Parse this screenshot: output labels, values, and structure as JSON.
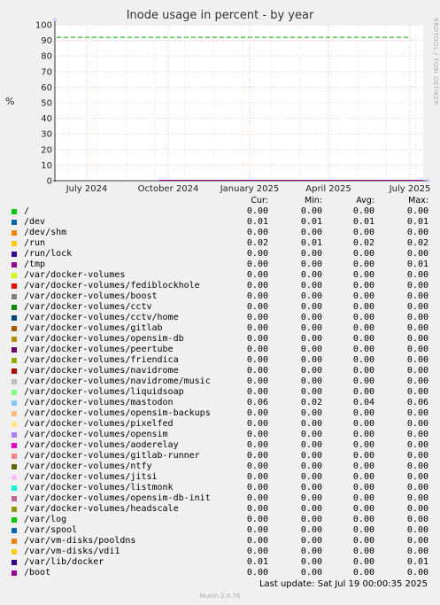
{
  "chart_data": {
    "type": "line",
    "title": "Inode usage in percent - by year",
    "ylabel": "%",
    "ylim": [
      0,
      100
    ],
    "yticks": [
      0,
      10,
      20,
      30,
      40,
      50,
      60,
      70,
      80,
      90,
      100
    ],
    "xticks": [
      "July 2024",
      "October 2024",
      "January 2025",
      "April 2025",
      "July 2025"
    ],
    "warning_line": 92,
    "grid": true,
    "legend_position": "bottom"
  },
  "sidetag": "RRDTOOL / TOBI OETIKER",
  "legend": {
    "headers": {
      "cur": "Cur:",
      "min": "Min:",
      "avg": "Avg:",
      "max": "Max:"
    },
    "rows": [
      {
        "name": "/",
        "color": "#00cc00",
        "cur": "0.00",
        "min": "0.00",
        "avg": "0.00",
        "max": "0.00"
      },
      {
        "name": "/dev",
        "color": "#0066b3",
        "cur": "0.01",
        "min": "0.01",
        "avg": "0.01",
        "max": "0.01"
      },
      {
        "name": "/dev/shm",
        "color": "#ff8000",
        "cur": "0.00",
        "min": "0.00",
        "avg": "0.00",
        "max": "0.00"
      },
      {
        "name": "/run",
        "color": "#ffcc00",
        "cur": "0.02",
        "min": "0.01",
        "avg": "0.02",
        "max": "0.02"
      },
      {
        "name": "/run/lock",
        "color": "#330099",
        "cur": "0.00",
        "min": "0.00",
        "avg": "0.00",
        "max": "0.00"
      },
      {
        "name": "/tmp",
        "color": "#990099",
        "cur": "0.00",
        "min": "0.00",
        "avg": "0.00",
        "max": "0.01"
      },
      {
        "name": "/var/docker-volumes",
        "color": "#ccff00",
        "cur": "0.00",
        "min": "0.00",
        "avg": "0.00",
        "max": "0.00"
      },
      {
        "name": "/var/docker-volumes/fediblockhole",
        "color": "#ff0000",
        "cur": "0.00",
        "min": "0.00",
        "avg": "0.00",
        "max": "0.00"
      },
      {
        "name": "/var/docker-volumes/boost",
        "color": "#808080",
        "cur": "0.00",
        "min": "0.00",
        "avg": "0.00",
        "max": "0.00"
      },
      {
        "name": "/var/docker-volumes/cctv",
        "color": "#008f00",
        "cur": "0.00",
        "min": "0.00",
        "avg": "0.00",
        "max": "0.00"
      },
      {
        "name": "/var/docker-volumes/cctv/home",
        "color": "#00487d",
        "cur": "0.00",
        "min": "0.00",
        "avg": "0.00",
        "max": "0.00"
      },
      {
        "name": "/var/docker-volumes/gitlab",
        "color": "#b35a00",
        "cur": "0.00",
        "min": "0.00",
        "avg": "0.00",
        "max": "0.00"
      },
      {
        "name": "/var/docker-volumes/opensim-db",
        "color": "#b38f00",
        "cur": "0.00",
        "min": "0.00",
        "avg": "0.00",
        "max": "0.00"
      },
      {
        "name": "/var/docker-volumes/peertube",
        "color": "#6b006b",
        "cur": "0.00",
        "min": "0.00",
        "avg": "0.00",
        "max": "0.00"
      },
      {
        "name": "/var/docker-volumes/friendica",
        "color": "#8fb300",
        "cur": "0.00",
        "min": "0.00",
        "avg": "0.00",
        "max": "0.00"
      },
      {
        "name": "/var/docker-volumes/navidrome",
        "color": "#b30000",
        "cur": "0.00",
        "min": "0.00",
        "avg": "0.00",
        "max": "0.00"
      },
      {
        "name": "/var/docker-volumes/navidrome/music",
        "color": "#bebebe",
        "cur": "0.00",
        "min": "0.00",
        "avg": "0.00",
        "max": "0.00"
      },
      {
        "name": "/var/docker-volumes/liquidsoap",
        "color": "#80ff80",
        "cur": "0.00",
        "min": "0.00",
        "avg": "0.00",
        "max": "0.00"
      },
      {
        "name": "/var/docker-volumes/mastodon",
        "color": "#80c9ff",
        "cur": "0.06",
        "min": "0.02",
        "avg": "0.04",
        "max": "0.06"
      },
      {
        "name": "/var/docker-volumes/opensim-backups",
        "color": "#ffc080",
        "cur": "0.00",
        "min": "0.00",
        "avg": "0.00",
        "max": "0.00"
      },
      {
        "name": "/var/docker-volumes/pixelfed",
        "color": "#ffe680",
        "cur": "0.00",
        "min": "0.00",
        "avg": "0.00",
        "max": "0.00"
      },
      {
        "name": "/var/docker-volumes/opensim",
        "color": "#aa80ff",
        "cur": "0.00",
        "min": "0.00",
        "avg": "0.00",
        "max": "0.00"
      },
      {
        "name": "/var/docker-volumes/aoderelay",
        "color": "#ee00cc",
        "cur": "0.00",
        "min": "0.00",
        "avg": "0.00",
        "max": "0.00"
      },
      {
        "name": "/var/docker-volumes/gitlab-runner",
        "color": "#ff8080",
        "cur": "0.00",
        "min": "0.00",
        "avg": "0.00",
        "max": "0.00"
      },
      {
        "name": "/var/docker-volumes/ntfy",
        "color": "#666600",
        "cur": "0.00",
        "min": "0.00",
        "avg": "0.00",
        "max": "0.00"
      },
      {
        "name": "/var/docker-volumes/jitsi",
        "color": "#ffbfff",
        "cur": "0.00",
        "min": "0.00",
        "avg": "0.00",
        "max": "0.00"
      },
      {
        "name": "/var/docker-volumes/listmonk",
        "color": "#00ffcc",
        "cur": "0.00",
        "min": "0.00",
        "avg": "0.00",
        "max": "0.00"
      },
      {
        "name": "/var/docker-volumes/opensim-db-init",
        "color": "#cc6699",
        "cur": "0.00",
        "min": "0.00",
        "avg": "0.00",
        "max": "0.00"
      },
      {
        "name": "/var/docker-volumes/headscale",
        "color": "#999900",
        "cur": "0.00",
        "min": "0.00",
        "avg": "0.00",
        "max": "0.00"
      },
      {
        "name": "/var/log",
        "color": "#00cc00",
        "cur": "0.00",
        "min": "0.00",
        "avg": "0.00",
        "max": "0.00"
      },
      {
        "name": "/var/spool",
        "color": "#0066b3",
        "cur": "0.00",
        "min": "0.00",
        "avg": "0.00",
        "max": "0.00"
      },
      {
        "name": "/var/vm-disks/pooldns",
        "color": "#ff8000",
        "cur": "0.00",
        "min": "0.00",
        "avg": "0.00",
        "max": "0.00"
      },
      {
        "name": "/var/vm-disks/vdi1",
        "color": "#ffcc00",
        "cur": "0.00",
        "min": "0.00",
        "avg": "0.00",
        "max": "0.00"
      },
      {
        "name": "/var/lib/docker",
        "color": "#330099",
        "cur": "0.01",
        "min": "0.00",
        "avg": "0.00",
        "max": "0.01"
      },
      {
        "name": "/boot",
        "color": "#990099",
        "cur": "0.00",
        "min": "0.00",
        "avg": "0.00",
        "max": "0.00"
      }
    ]
  },
  "last_update": "Last update:  Sat Jul 19 00:00:35 2025",
  "footer": "Munin 2.0.76"
}
